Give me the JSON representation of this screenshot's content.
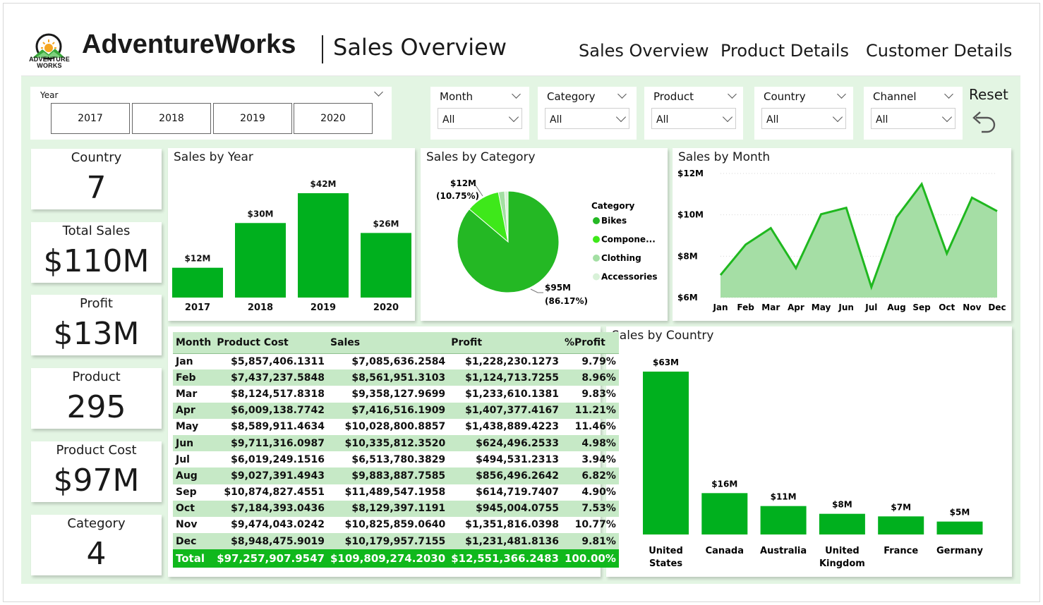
{
  "header": {
    "logo_text_line1": "ADVENTURE",
    "logo_text_line2": "WORKS",
    "app_title": "AdventureWorks",
    "page_title": "Sales Overview",
    "nav": [
      "Sales Overview",
      "Product Details",
      "Customer Details"
    ]
  },
  "colors": {
    "accent": "#00b01e",
    "light_green": "#e3f5e3",
    "table_alt": "#c6e9c6",
    "area_fill": "#a5dea5"
  },
  "slicers": {
    "year": {
      "label": "Year",
      "options": [
        "2017",
        "2018",
        "2019",
        "2020"
      ]
    },
    "dropdowns": [
      {
        "label": "Month",
        "value": "All"
      },
      {
        "label": "Category",
        "value": "All"
      },
      {
        "label": "Product",
        "value": "All"
      },
      {
        "label": "Country",
        "value": "All"
      },
      {
        "label": "Channel",
        "value": "All"
      }
    ],
    "reset_label": "Reset"
  },
  "kpis": [
    {
      "label": "Country",
      "value": "7"
    },
    {
      "label": "Total Sales",
      "value": "$110M"
    },
    {
      "label": "Profit",
      "value": "$13M"
    },
    {
      "label": "Product",
      "value": "295"
    },
    {
      "label": "Product Cost",
      "value": "$97M"
    },
    {
      "label": "Category",
      "value": "4"
    }
  ],
  "chart_data": [
    {
      "id": "sales_by_year",
      "type": "bar",
      "title": "Sales by Year",
      "categories": [
        "2017",
        "2018",
        "2019",
        "2020"
      ],
      "values": [
        12,
        30,
        42,
        26
      ],
      "data_labels": [
        "$12M",
        "$30M",
        "$42M",
        "$26M"
      ],
      "ylim": [
        0,
        42
      ]
    },
    {
      "id": "sales_by_category",
      "type": "pie",
      "title": "Sales by Category",
      "legend_title": "Category",
      "legend_position": "right",
      "categories": [
        "Bikes",
        "Compone...",
        "Clothing",
        "Accessories"
      ],
      "values": [
        86.17,
        10.75,
        2.0,
        1.08
      ],
      "colors": [
        "#24b824",
        "#3ee81a",
        "#a3dfa3",
        "#d8f1d8"
      ],
      "data_labels": [
        {
          "category": "Bikes",
          "value": "$95M",
          "pct": "(86.17%)"
        },
        {
          "category": "Compone...",
          "value": "$12M",
          "pct": "(10.75%)"
        }
      ]
    },
    {
      "id": "sales_by_month",
      "type": "area",
      "title": "Sales by Month",
      "categories": [
        "Jan",
        "Feb",
        "Mar",
        "Apr",
        "May",
        "Jun",
        "Jul",
        "Aug",
        "Sep",
        "Oct",
        "Nov",
        "Dec"
      ],
      "values": [
        7.09,
        8.56,
        9.36,
        7.42,
        10.03,
        10.34,
        6.51,
        9.88,
        11.49,
        8.13,
        10.83,
        10.18
      ],
      "ylim": [
        6,
        12
      ],
      "yticks": [
        "$6M",
        "$8M",
        "$10M",
        "$12M"
      ],
      "ytick_values": [
        6,
        8,
        10,
        12
      ],
      "grid": true
    },
    {
      "id": "sales_by_country",
      "type": "bar",
      "title": "Sales by Country",
      "categories": [
        "United States",
        "Canada",
        "Australia",
        "United Kingdom",
        "France",
        "Germany"
      ],
      "category_lines": [
        [
          "United",
          "States"
        ],
        [
          "Canada"
        ],
        [
          "Australia"
        ],
        [
          "United",
          "Kingdom"
        ],
        [
          "France"
        ],
        [
          "Germany"
        ]
      ],
      "values": [
        63,
        16,
        11,
        8,
        7,
        5
      ],
      "data_labels": [
        "$63M",
        "$16M",
        "$11M",
        "$8M",
        "$7M",
        "$5M"
      ],
      "ylim": [
        0,
        63
      ]
    }
  ],
  "table": {
    "columns": [
      "Month",
      "Product Cost",
      "Sales",
      "Profit",
      "%Profit"
    ],
    "rows": [
      [
        "Jan",
        "$5,857,406.1311",
        "$7,085,636.2584",
        "$1,228,230.1273",
        "9.79%"
      ],
      [
        "Feb",
        "$7,437,237.5848",
        "$8,561,951.3103",
        "$1,124,713.7255",
        "8.96%"
      ],
      [
        "Mar",
        "$8,124,517.8318",
        "$9,358,127.9699",
        "$1,233,610.1381",
        "9.83%"
      ],
      [
        "Apr",
        "$6,009,138.7742",
        "$7,416,516.1909",
        "$1,407,377.4167",
        "11.21%"
      ],
      [
        "May",
        "$8,589,911.4634",
        "$10,028,800.8857",
        "$1,438,889.4223",
        "11.46%"
      ],
      [
        "Jun",
        "$9,711,316.0987",
        "$10,335,812.3520",
        "$624,496.2533",
        "4.98%"
      ],
      [
        "Jul",
        "$6,019,249.1516",
        "$6,513,780.3829",
        "$494,531.2313",
        "3.94%"
      ],
      [
        "Aug",
        "$9,027,391.4943",
        "$9,883,887.7585",
        "$856,496.2642",
        "6.82%"
      ],
      [
        "Sep",
        "$10,874,827.4551",
        "$11,489,547.1958",
        "$614,719.7407",
        "4.90%"
      ],
      [
        "Oct",
        "$7,184,393.0436",
        "$8,129,397.1191",
        "$945,004.0755",
        "7.53%"
      ],
      [
        "Nov",
        "$9,474,043.0242",
        "$10,825,859.0640",
        "$1,351,816.0398",
        "10.77%"
      ],
      [
        "Dec",
        "$8,948,475.9019",
        "$10,179,957.7155",
        "$1,231,481.8136",
        "9.81%"
      ]
    ],
    "total": [
      "Total",
      "$97,257,907.9547",
      "$109,809,274.2030",
      "$12,551,366.2483",
      "100.00%"
    ]
  }
}
